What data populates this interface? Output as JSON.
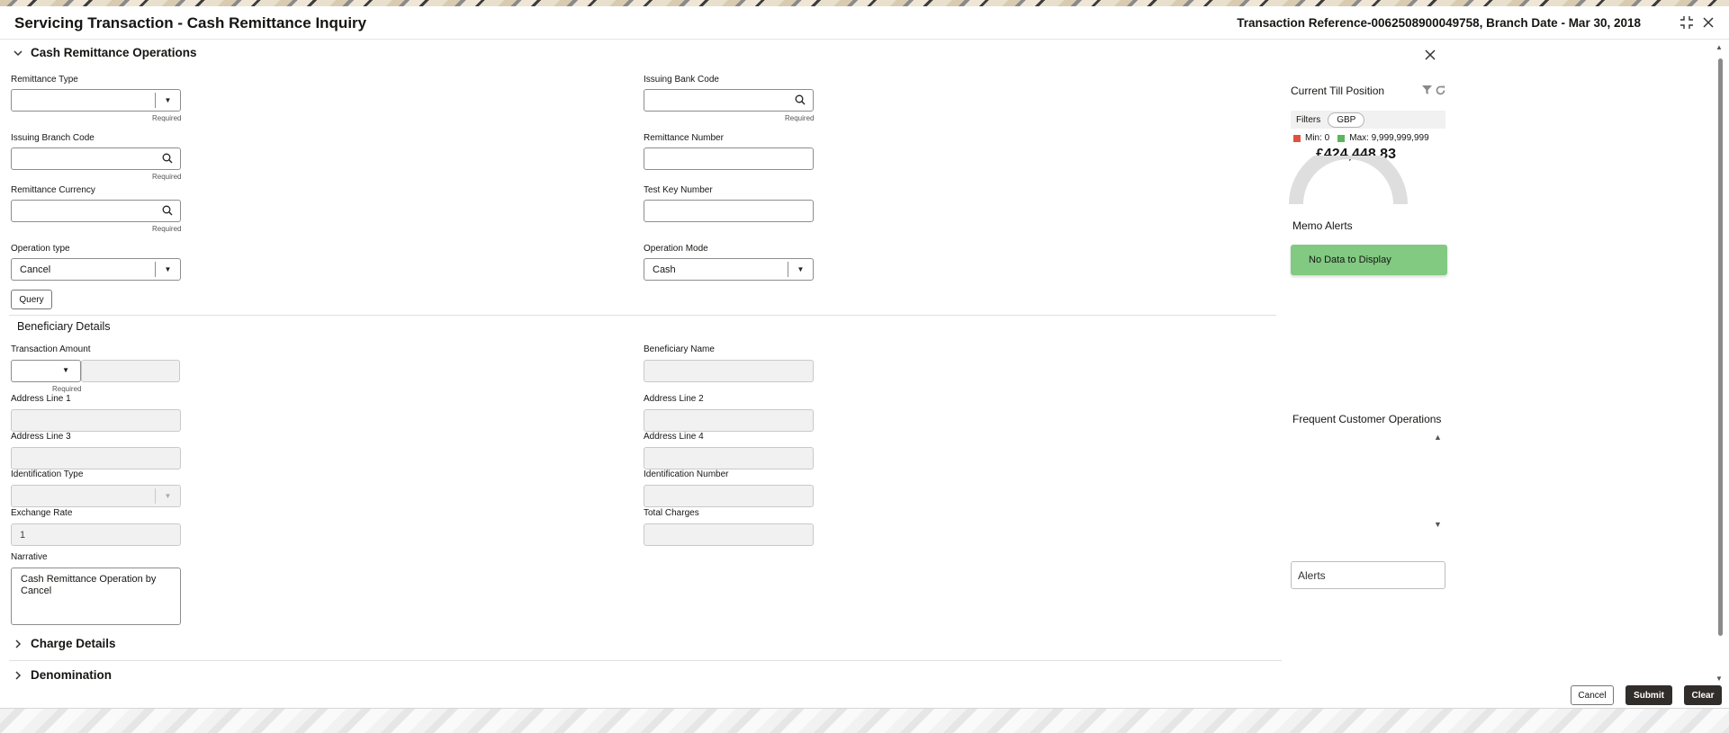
{
  "window": {
    "title": "Servicing Transaction - Cash Remittance Inquiry",
    "transaction_reference": "Transaction Reference-0062508900049758, Branch Date - Mar 30, 2018"
  },
  "operations": {
    "section_title": "Cash Remittance Operations",
    "required_text": "Required",
    "remittance_type": {
      "label": "Remittance Type",
      "value": ""
    },
    "issuing_bank_code": {
      "label": "Issuing Bank Code",
      "value": ""
    },
    "issuing_branch_code": {
      "label": "Issuing Branch Code",
      "value": ""
    },
    "remittance_number": {
      "label": "Remittance Number",
      "value": ""
    },
    "remittance_currency": {
      "label": "Remittance Currency",
      "value": ""
    },
    "test_key_number": {
      "label": "Test Key Number",
      "value": ""
    },
    "operation_type": {
      "label": "Operation type",
      "value": "Cancel"
    },
    "operation_mode": {
      "label": "Operation Mode",
      "value": "Cash"
    },
    "query_label": "Query"
  },
  "beneficiary": {
    "section_title": "Beneficiary Details",
    "transaction_amount": {
      "label": "Transaction Amount",
      "currency": "",
      "value": ""
    },
    "beneficiary_name": {
      "label": "Beneficiary Name",
      "value": ""
    },
    "address_line_1": {
      "label": "Address Line 1",
      "value": ""
    },
    "address_line_2": {
      "label": "Address Line 2",
      "value": ""
    },
    "address_line_3": {
      "label": "Address Line 3",
      "value": ""
    },
    "address_line_4": {
      "label": "Address Line 4",
      "value": ""
    },
    "identification_type": {
      "label": "Identification Type",
      "value": ""
    },
    "identification_number": {
      "label": "Identification Number",
      "value": ""
    },
    "exchange_rate": {
      "label": "Exchange Rate",
      "value": "1"
    },
    "total_charges": {
      "label": "Total Charges",
      "value": ""
    },
    "narrative": {
      "label": "Narrative",
      "value": "Cash Remittance Operation by Cancel"
    }
  },
  "collapsed_sections": {
    "charge_details": "Charge Details",
    "denomination": "Denomination"
  },
  "side_panel": {
    "till_title": "Current Till Position",
    "filters_label": "Filters",
    "currency_chip": "GBP",
    "min_label": "Min: 0",
    "max_label": "Max: 9,999,999,999",
    "amount": "£424,448.83",
    "min_color": "#e0523f",
    "max_color": "#5bb55b",
    "memo_title": "Memo Alerts",
    "memo_empty": "No Data to Display",
    "frequent_title": "Frequent Customer Operations",
    "alerts_label": "Alerts"
  },
  "footer": {
    "cancel_label": "Cancel",
    "submit_label": "Submit",
    "clear_label": "Clear"
  }
}
